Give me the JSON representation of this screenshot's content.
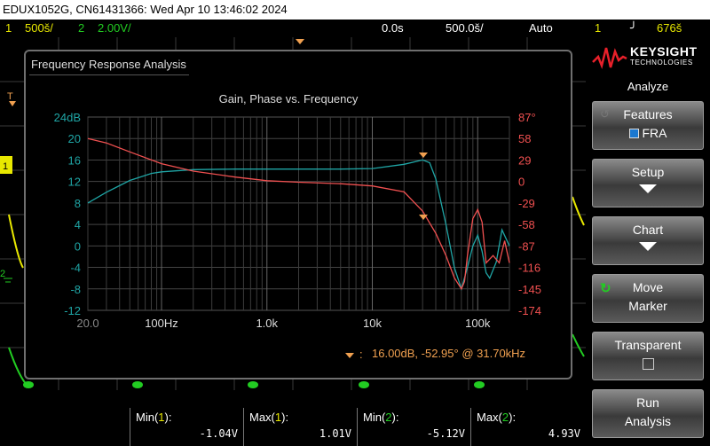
{
  "window": {
    "title": "EDUX1052G, CN61431366: Wed Apr 10 13:46:02 2024"
  },
  "status": {
    "ch1_num": "1",
    "ch1_scale": "500š/",
    "ch2_num": "2",
    "ch2_scale": "2.00V/",
    "time_delay": "0.0s",
    "time_scale": "500.0š/",
    "trigger_mode": "Auto",
    "trig_channel": "1",
    "trig_level": "676š"
  },
  "fra": {
    "window_title": "Frequency Response Analysis",
    "plot_title": "Gain, Phase vs. Frequency",
    "marker_readout": "16.00dB, -52.95° @ 31.70kHz"
  },
  "chart_data": {
    "type": "line",
    "x_scale": "log",
    "x_ticks": [
      "20.0",
      "100Hz",
      "1.0k",
      "10k",
      "100k"
    ],
    "x_tick_values": [
      20,
      100,
      1000,
      10000,
      100000
    ],
    "xlim": [
      20,
      200000
    ],
    "y_left_ticks": [
      "24dB",
      "20",
      "16",
      "12",
      "8",
      "4",
      "0",
      "-4",
      "-8",
      "-12"
    ],
    "y_left_range": [
      -12,
      24
    ],
    "y_right_ticks": [
      "87°",
      "58",
      "29",
      "0",
      "-29",
      "-58",
      "-87",
      "-116",
      "-145",
      "-174"
    ],
    "y_right_range": [
      -174,
      87
    ],
    "grid": true,
    "series": [
      {
        "color": "#1fa5a5",
        "axis": "left",
        "x": [
          20,
          30,
          50,
          80,
          100,
          200,
          500,
          1000,
          5000,
          10000,
          20000,
          30000,
          35000,
          40000,
          50000,
          60000,
          70000,
          80000,
          90000,
          100000,
          110000,
          120000,
          130000,
          150000,
          170000,
          200000
        ],
        "y": [
          8,
          10,
          12.2,
          13.5,
          13.8,
          14.2,
          14.3,
          14.3,
          14.3,
          14.4,
          15.2,
          16,
          15.5,
          12.5,
          4,
          -4,
          -8,
          -4,
          0,
          2,
          -1,
          -5,
          -6,
          -3,
          3,
          0
        ]
      },
      {
        "color": "#f05050",
        "axis": "right",
        "x": [
          20,
          30,
          50,
          100,
          200,
          500,
          1000,
          2000,
          5000,
          10000,
          20000,
          30000,
          40000,
          50000,
          60000,
          70000,
          75000,
          80000,
          90000,
          100000,
          110000,
          120000,
          140000,
          160000,
          180000,
          200000
        ],
        "y": [
          58,
          52,
          40,
          24,
          14,
          6,
          1,
          -1,
          -3,
          -6,
          -14,
          -40,
          -70,
          -100,
          -130,
          -145,
          -135,
          -100,
          -50,
          -38,
          -55,
          -110,
          -100,
          -110,
          -80,
          -110
        ]
      }
    ]
  },
  "softkeys": {
    "menu_title": "Analyze",
    "features": "Features",
    "features_value": "FRA",
    "setup": "Setup",
    "chart": "Chart",
    "move": "Move",
    "marker": "Marker",
    "transparent": "Transparent",
    "run": "Run",
    "analysis": "Analysis"
  },
  "brand": {
    "name": "KEYSIGHT",
    "sub": "TECHNOLOGIES"
  },
  "measurements": [
    {
      "label_pre": "Min(",
      "ch": "1",
      "label_post": "):",
      "value": "-1.04V"
    },
    {
      "label_pre": "Max(",
      "ch": "1",
      "label_post": "):",
      "value": "1.01V"
    },
    {
      "label_pre": "Min(",
      "ch": "2",
      "label_post": "):",
      "value": "-5.12V"
    },
    {
      "label_pre": "Max(",
      "ch": "2",
      "label_post": "):",
      "value": "4.93V"
    }
  ],
  "colors": {
    "ch1": "#e8e800",
    "ch2": "#22cc22",
    "gain": "#1fa5a5",
    "phase": "#f05050",
    "marker": "#f0a050"
  }
}
